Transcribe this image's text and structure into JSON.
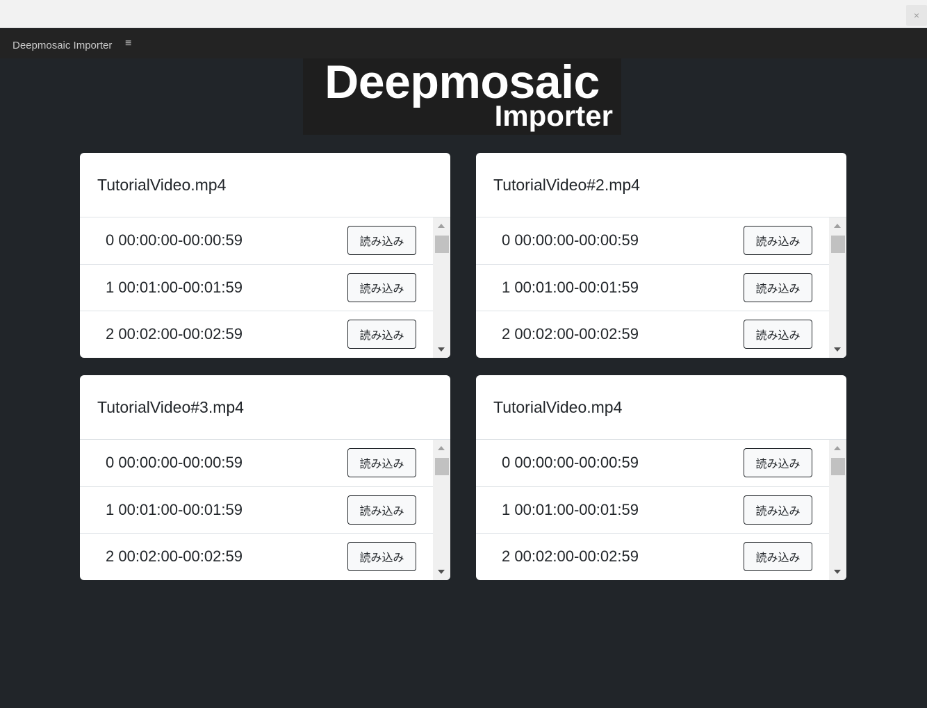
{
  "window": {
    "close_glyph": "×"
  },
  "panel": {
    "title": "Deepmosaic Importer",
    "menu_glyph": "≡"
  },
  "logo": {
    "main": "Deepmosaic",
    "sub": "Importer"
  },
  "cards": [
    {
      "title": "TutorialVideo.mp4",
      "rows": [
        {
          "label": "0 00:00:00-00:00:59",
          "button": "読み込み"
        },
        {
          "label": "1 00:01:00-00:01:59",
          "button": "読み込み"
        },
        {
          "label": "2 00:02:00-00:02:59",
          "button": "読み込み"
        }
      ]
    },
    {
      "title": "TutorialVideo#2.mp4",
      "rows": [
        {
          "label": "0 00:00:00-00:00:59",
          "button": "読み込み"
        },
        {
          "label": "1 00:01:00-00:01:59",
          "button": "読み込み"
        },
        {
          "label": "2 00:02:00-00:02:59",
          "button": "読み込み"
        }
      ]
    },
    {
      "title": "TutorialVideo#3.mp4",
      "rows": [
        {
          "label": "0 00:00:00-00:00:59",
          "button": "読み込み"
        },
        {
          "label": "1 00:01:00-00:01:59",
          "button": "読み込み"
        },
        {
          "label": "2 00:02:00-00:02:59",
          "button": "読み込み"
        }
      ]
    },
    {
      "title": "TutorialVideo.mp4",
      "rows": [
        {
          "label": "0 00:00:00-00:00:59",
          "button": "読み込み"
        },
        {
          "label": "1 00:01:00-00:01:59",
          "button": "読み込み"
        },
        {
          "label": "2 00:02:00-00:02:59",
          "button": "読み込み"
        }
      ]
    }
  ]
}
